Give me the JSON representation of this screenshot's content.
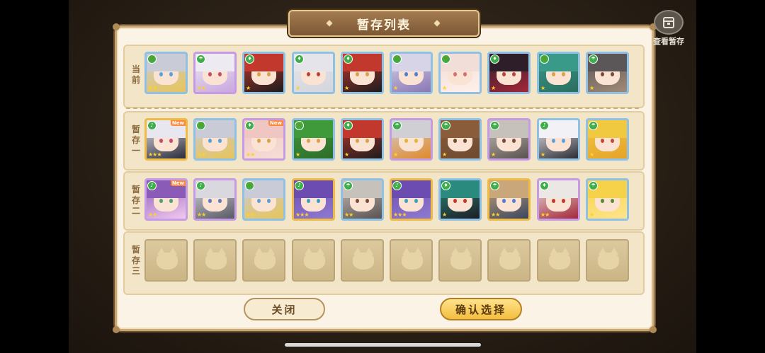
{
  "title": "暂存列表",
  "view_saved_label": "查看暂存",
  "rows": [
    {
      "label": "当前",
      "slots": [
        {
          "hair": "#c9ccd6",
          "accent": "#e7c45a",
          "frame": "#8fc1e6",
          "eye": "#5aa0d8",
          "el": "🌿",
          "stars": "★★",
          "new": ""
        },
        {
          "hair": "#eeeaf2",
          "accent": "#c9a7e0",
          "frame": "#c59be6",
          "eye": "#c24a6a",
          "el": "☂",
          "stars": "★★",
          "new": ""
        },
        {
          "hair": "#c2382c",
          "accent": "#1d1d1d",
          "frame": "#8fc1e6",
          "eye": "#d8a24a",
          "el": "♦",
          "stars": "★",
          "new": ""
        },
        {
          "hair": "#e4e4ea",
          "accent": "#d5d5dd",
          "frame": "#8fc1e6",
          "eye": "#b7443c",
          "el": "♦",
          "stars": "★",
          "new": ""
        },
        {
          "hair": "#c2382c",
          "accent": "#1d1d1d",
          "frame": "#8fc1e6",
          "eye": "#d8a24a",
          "el": "♦",
          "stars": "★",
          "new": ""
        },
        {
          "hair": "#d6d4e6",
          "accent": "#8b77b5",
          "frame": "#8fc1e6",
          "eye": "#4f7fd0",
          "el": "🌿",
          "stars": "★",
          "new": ""
        },
        {
          "hair": "#f1ded8",
          "accent": "#fff0ea",
          "frame": "#8fc1e6",
          "eye": "#d66d78",
          "el": "🌿",
          "stars": "★",
          "new": ""
        },
        {
          "hair": "#2d1e2a",
          "accent": "#a3283a",
          "frame": "#8fc1e6",
          "eye": "#b7443c",
          "el": "♦",
          "stars": "★",
          "new": ""
        },
        {
          "hair": "#3a9a8a",
          "accent": "#2a6e60",
          "frame": "#8fc1e6",
          "eye": "#d8a24a",
          "el": "🌿",
          "stars": "★",
          "new": ""
        },
        {
          "hair": "#5b5658",
          "accent": "#a08a76",
          "frame": "#8fc1e6",
          "eye": "#7a4b3a",
          "el": "☂",
          "stars": "★",
          "new": ""
        }
      ]
    },
    {
      "label": "暂存一",
      "slots": [
        {
          "hair": "#e8e6ee",
          "accent": "#2b2b3a",
          "frame": "#f0bb45",
          "eye": "#c24a6a",
          "el": "♪",
          "stars": "★★★",
          "new": "New"
        },
        {
          "hair": "#c9ccd6",
          "accent": "#e7c45a",
          "frame": "#8fc1e6",
          "eye": "#5aa0d8",
          "el": "🌿",
          "stars": "★★",
          "new": ""
        },
        {
          "hair": "#efc6c2",
          "accent": "#f6ddd7",
          "frame": "#c59be6",
          "eye": "#d8a24a",
          "el": "♦",
          "stars": "★★",
          "new": "New"
        },
        {
          "hair": "#3f9a3a",
          "accent": "#2d6d2c",
          "frame": "#8fc1e6",
          "eye": "#d8a24a",
          "el": "🌿",
          "stars": "★",
          "new": ""
        },
        {
          "hair": "#c2382c",
          "accent": "#1d1d1d",
          "frame": "#8fc1e6",
          "eye": "#d8a24a",
          "el": "♦",
          "stars": "★",
          "new": ""
        },
        {
          "hair": "#d0d0d4",
          "accent": "#e08a2c",
          "frame": "#c59be6",
          "eye": "#e6b43a",
          "el": "☂",
          "stars": "★",
          "new": ""
        },
        {
          "hair": "#8a5c3a",
          "accent": "#6f4a2f",
          "frame": "#8fc1e6",
          "eye": "#6b4a2a",
          "el": "☂",
          "stars": "★",
          "new": ""
        },
        {
          "hair": "#c7c1bb",
          "accent": "#5a5250",
          "frame": "#c59be6",
          "eye": "#7a4b3a",
          "el": "☂",
          "stars": "★",
          "new": ""
        },
        {
          "hair": "#f2f2f6",
          "accent": "#2d2d36",
          "frame": "#8fc1e6",
          "eye": "#5aa0d8",
          "el": "♪",
          "stars": "★",
          "new": ""
        },
        {
          "hair": "#f0c940",
          "accent": "#e6a32a",
          "frame": "#8fc1e6",
          "eye": "#c24a3a",
          "el": "☂",
          "stars": "★",
          "new": ""
        }
      ]
    },
    {
      "label": "暂存二",
      "slots": [
        {
          "hair": "#8a5cb8",
          "accent": "#f2c9ee",
          "frame": "#c59be6",
          "eye": "#4fa070",
          "el": "♪",
          "stars": "★★",
          "new": "New"
        },
        {
          "hair": "#d8d8de",
          "accent": "#5a5a66",
          "frame": "#c59be6",
          "eye": "#5a7fc0",
          "el": "♪",
          "stars": "★★",
          "new": ""
        },
        {
          "hair": "#c9ccd6",
          "accent": "#e7c45a",
          "frame": "#8fc1e6",
          "eye": "#5aa0d8",
          "el": "🌿",
          "stars": "★★",
          "new": ""
        },
        {
          "hair": "#6c4cb0",
          "accent": "#8f7ad0",
          "frame": "#f0bb45",
          "eye": "#3aa0c0",
          "el": "♪",
          "stars": "★★★",
          "new": ""
        },
        {
          "hair": "#c7c1bb",
          "accent": "#5a5250",
          "frame": "#8fc1e6",
          "eye": "#7a4b3a",
          "el": "☂",
          "stars": "★★",
          "new": ""
        },
        {
          "hair": "#6c4cb0",
          "accent": "#8f7ad0",
          "frame": "#f0bb45",
          "eye": "#3aa0c0",
          "el": "♪",
          "stars": "★★★",
          "new": ""
        },
        {
          "hair": "#2a8a7e",
          "accent": "#1d1d24",
          "frame": "#8fc1e6",
          "eye": "#c2382c",
          "el": "♦",
          "stars": "★",
          "new": ""
        },
        {
          "hair": "#c9a77a",
          "accent": "#3b4660",
          "frame": "#f0bb45",
          "eye": "#4f7fd0",
          "el": "☂",
          "stars": "★★",
          "new": ""
        },
        {
          "hair": "#ebe7e4",
          "accent": "#a3283a",
          "frame": "#c59be6",
          "eye": "#c2382c",
          "el": "♦",
          "stars": "★★",
          "new": ""
        },
        {
          "hair": "#f5d24a",
          "accent": "#ffe48a",
          "frame": "#8fc1e6",
          "eye": "#5a8a2a",
          "el": "☂",
          "stars": "★",
          "new": ""
        }
      ]
    },
    {
      "label": "暂存三",
      "slots": [
        {
          "empty": true
        },
        {
          "empty": true
        },
        {
          "empty": true
        },
        {
          "empty": true
        },
        {
          "empty": true
        },
        {
          "empty": true
        },
        {
          "empty": true
        },
        {
          "empty": true
        },
        {
          "empty": true
        },
        {
          "empty": true
        }
      ]
    }
  ],
  "buttons": {
    "close": "关闭",
    "confirm": "确认选择"
  },
  "colors": {
    "panel_bg": "#fbf4e6",
    "row_bg": "#f3e6c8",
    "confirm_btn": "#f2be3f",
    "title_plate": "#7c5734"
  }
}
